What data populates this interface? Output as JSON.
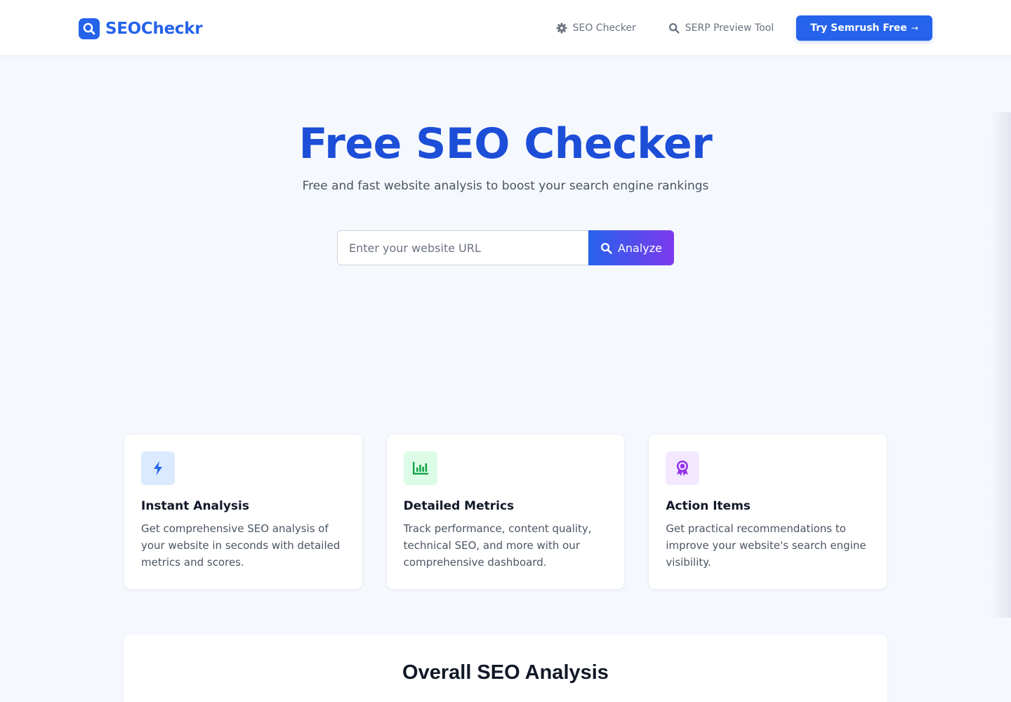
{
  "header": {
    "brand": "SEOCheckr",
    "nav": [
      {
        "label": "SEO Checker",
        "icon": "gear-icon"
      },
      {
        "label": "SERP Preview Tool",
        "icon": "search-icon"
      }
    ],
    "cta": {
      "label": "Try Semrush Free",
      "arrow": "→"
    }
  },
  "hero": {
    "title": "Free SEO Checker",
    "subtitle": "Free and fast website analysis to boost your search engine rankings",
    "search": {
      "placeholder": "Enter your website URL",
      "value": "",
      "button_label": "Analyze"
    }
  },
  "features": [
    {
      "icon": "lightning-bolt-icon",
      "title": "Instant Analysis",
      "description": "Get comprehensive SEO analysis of your website in seconds with detailed metrics and scores."
    },
    {
      "icon": "bar-chart-icon",
      "title": "Detailed Metrics",
      "description": "Track performance, content quality, technical SEO, and more with our comprehensive dashboard."
    },
    {
      "icon": "award-ribbon-icon",
      "title": "Action Items",
      "description": "Get practical recommendations to improve your website's search engine visibility."
    }
  ],
  "overall": {
    "title": "Overall SEO Analysis"
  },
  "colors": {
    "primary": "#2563eb",
    "title_blue": "#1d4ed8",
    "gradient_end": "#7c3aed",
    "page_bg": "#f5f8fd",
    "green": "#16a34a",
    "purple": "#9333ea"
  }
}
